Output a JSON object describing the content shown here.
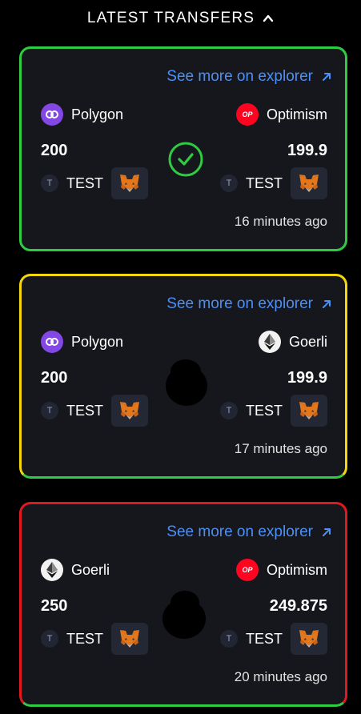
{
  "header": {
    "title": "LATEST TRANSFERS",
    "caret_icon": "chevron-up-icon"
  },
  "colors": {
    "success": "#2ecc40",
    "pending": "#f5d60a",
    "failed": "#e0191e",
    "link": "#4c8ff5",
    "card_bg": "#16171c"
  },
  "transfers": [
    {
      "explorer_label": "See more on explorer",
      "from": {
        "chain": "Polygon",
        "amount": "200",
        "token": "TEST",
        "token_badge": "T"
      },
      "to": {
        "chain": "Optimism",
        "amount": "199.9",
        "token": "TEST",
        "token_badge": "T"
      },
      "time": "16 minutes ago",
      "status_icon": "check-circle-icon"
    },
    {
      "explorer_label": "See more on explorer",
      "from": {
        "chain": "Polygon",
        "amount": "200",
        "token": "TEST",
        "token_badge": "T"
      },
      "to": {
        "chain": "Goerli",
        "amount": "199.9",
        "token": "TEST",
        "token_badge": "T"
      },
      "time": "17 minutes ago",
      "status_icon": "redacted-blob"
    },
    {
      "explorer_label": "See more on explorer",
      "from": {
        "chain": "Goerli",
        "amount": "250",
        "token": "TEST",
        "token_badge": "T"
      },
      "to": {
        "chain": "Optimism",
        "amount": "249.875",
        "token": "TEST",
        "token_badge": "T"
      },
      "time": "20 minutes ago",
      "status_icon": "redacted-blob"
    }
  ],
  "chain_logo_text": {
    "optimism": "OP"
  }
}
